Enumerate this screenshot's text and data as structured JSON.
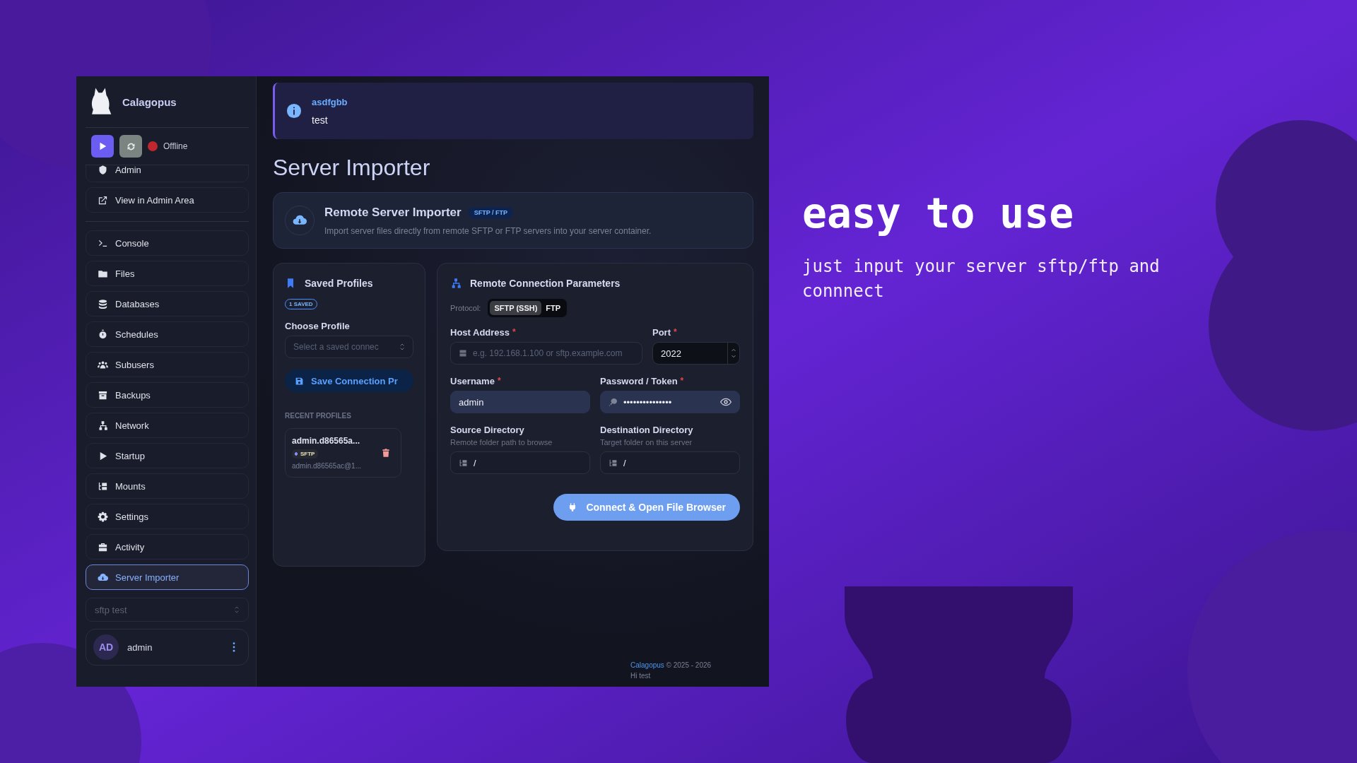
{
  "sidebar": {
    "brand": "Calagopus",
    "status": "Offline",
    "nav": [
      {
        "label": "Admin",
        "selected": false
      },
      {
        "label": "View in Admin Area",
        "selected": false
      },
      {
        "label": "Console",
        "selected": false
      },
      {
        "label": "Files",
        "selected": false
      },
      {
        "label": "Databases",
        "selected": false
      },
      {
        "label": "Schedules",
        "selected": false
      },
      {
        "label": "Subusers",
        "selected": false
      },
      {
        "label": "Backups",
        "selected": false
      },
      {
        "label": "Network",
        "selected": false
      },
      {
        "label": "Startup",
        "selected": false
      },
      {
        "label": "Mounts",
        "selected": false
      },
      {
        "label": "Settings",
        "selected": false
      },
      {
        "label": "Activity",
        "selected": false
      },
      {
        "label": "Server Importer",
        "selected": true
      }
    ],
    "server_select": "sftp test",
    "user": {
      "initials": "AD",
      "name": "admin"
    }
  },
  "alert": {
    "title": "asdfgbb",
    "message": "test"
  },
  "page_title": "Server Importer",
  "hero": {
    "title": "Remote Server Importer",
    "badge": "SFTP / FTP",
    "description": "Import server files directly from remote SFTP or FTP servers into your server container."
  },
  "saved_profiles": {
    "title": "Saved Profiles",
    "count_badge": "1 SAVED",
    "choose_label": "Choose Profile",
    "select_placeholder": "Select a saved connec",
    "save_button": "Save Connection Pr",
    "recent_heading": "RECENT PROFILES",
    "recent": [
      {
        "name": "admin.d86565a...",
        "protocol": "SFTP",
        "detail": "admin.d86565ac@1..."
      }
    ]
  },
  "connection": {
    "title": "Remote Connection Parameters",
    "protocol_label": "Protocol:",
    "protocols": [
      {
        "label": "SFTP (SSH)",
        "selected": true
      },
      {
        "label": "FTP",
        "selected": false
      }
    ],
    "rows": [
      [
        {
          "kind": "host",
          "label": "Host Address",
          "required_mark": "*",
          "placeholder": "e.g. 192.168.1.100 or sftp.example.com"
        },
        {
          "kind": "number",
          "label": "Port",
          "required_mark": "*",
          "value": "2022"
        }
      ],
      [
        {
          "kind": "text",
          "label": "Username",
          "required_mark": "*",
          "value": "admin"
        },
        {
          "kind": "password",
          "label": "Password / Token",
          "required_mark": "*",
          "value": "•••••••••••••••"
        }
      ],
      [
        {
          "kind": "folder",
          "label": "Source Directory",
          "hint": "Remote folder path to browse",
          "value": "/"
        },
        {
          "kind": "folder",
          "label": "Destination Directory",
          "hint": "Target folder on this server",
          "value": "/"
        }
      ]
    ],
    "connect_button": "Connect & Open File Browser"
  },
  "footer": {
    "brand": "Calagopus",
    "copyright": "© 2025 - 2026",
    "note": "Hi test"
  },
  "promo": {
    "headline": "easy to use",
    "subtitle": "just input your server sftp/ftp and connnect"
  }
}
